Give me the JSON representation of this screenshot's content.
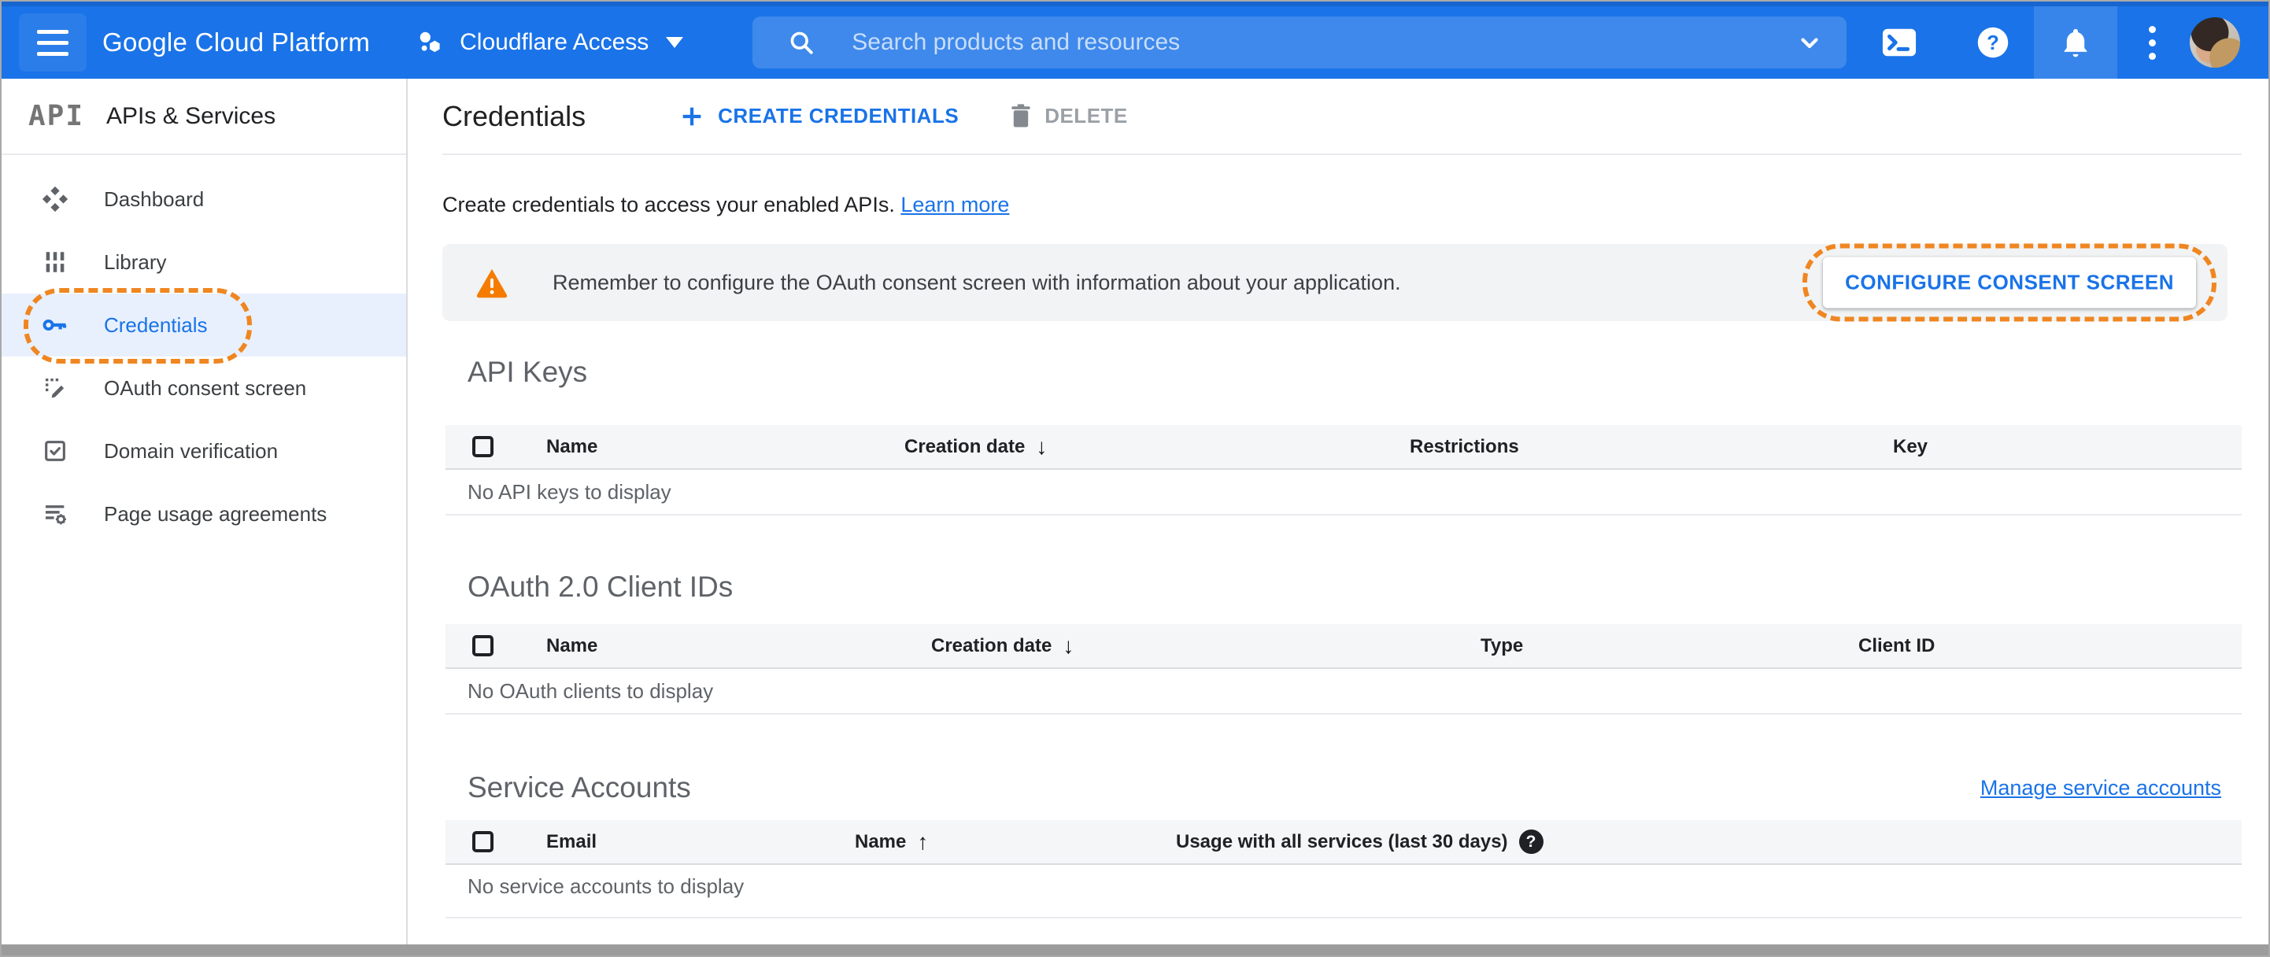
{
  "header": {
    "brand": "Google Cloud Platform",
    "project_selector": "Cloudflare Access",
    "search_placeholder": "Search products and resources"
  },
  "sidebar": {
    "logo": "API",
    "title": "APIs & Services",
    "items": [
      {
        "label": "Dashboard",
        "icon": "dashboard-icon",
        "selected": false
      },
      {
        "label": "Library",
        "icon": "library-icon",
        "selected": false
      },
      {
        "label": "Credentials",
        "icon": "key-icon",
        "selected": true,
        "annotated": true
      },
      {
        "label": "OAuth consent screen",
        "icon": "consent-screen-icon",
        "selected": false
      },
      {
        "label": "Domain verification",
        "icon": "domain-verification-icon",
        "selected": false
      },
      {
        "label": "Page usage agreements",
        "icon": "agreements-icon",
        "selected": false
      }
    ]
  },
  "toolbar": {
    "title": "Credentials",
    "create_label": "CREATE CREDENTIALS",
    "delete_label": "DELETE"
  },
  "intro": {
    "text": "Create credentials to access your enabled APIs.",
    "link": "Learn more"
  },
  "banner": {
    "text": "Remember to configure the OAuth consent screen with information about your application.",
    "button": "CONFIGURE CONSENT SCREEN",
    "icon": "warning-icon"
  },
  "sections": {
    "api_keys": {
      "title": "API Keys",
      "columns": [
        "Name",
        "Creation date",
        "Restrictions",
        "Key"
      ],
      "sort_column": "Creation date",
      "sort_direction": "desc",
      "empty": "No API keys to display"
    },
    "oauth_clients": {
      "title": "OAuth 2.0 Client IDs",
      "columns": [
        "Name",
        "Creation date",
        "Type",
        "Client ID"
      ],
      "sort_column": "Creation date",
      "sort_direction": "desc",
      "empty": "No OAuth clients to display"
    },
    "service_accounts": {
      "title": "Service Accounts",
      "manage_link": "Manage service accounts",
      "columns": [
        "Email",
        "Name",
        "Usage with all services (last 30 days)"
      ],
      "sort_column": "Name",
      "sort_direction": "asc",
      "help_column": "Usage with all services (last 30 days)",
      "empty": "No service accounts to display"
    }
  },
  "colors": {
    "accent_blue": "#1a73e8",
    "annotation_orange": "#ef8621",
    "warning_orange": "#f57c00",
    "selected_item_bg": "#e8f0fe",
    "banner_bg": "#f1f3f4"
  }
}
